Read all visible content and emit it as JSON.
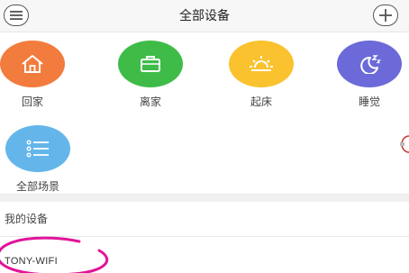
{
  "header": {
    "title": "全部设备",
    "menu_icon": "menu-icon",
    "add_icon": "plus-icon"
  },
  "scenes": [
    {
      "label": "回家",
      "icon": "home-icon",
      "color": "#f27c3d"
    },
    {
      "label": "离家",
      "icon": "briefcase-icon",
      "color": "#3fbc48"
    },
    {
      "label": "起床",
      "icon": "sunrise-icon",
      "color": "#f9c22e"
    },
    {
      "label": "睡觉",
      "icon": "moon-sleep-icon",
      "color": "#6b6ad8"
    },
    {
      "label": "全部场景",
      "icon": "list-icon",
      "color": "#64b6ea"
    }
  ],
  "devices": {
    "section_title": "我的设备",
    "items": [
      {
        "name": "TONY-WIFI"
      }
    ]
  },
  "annotation": {
    "color": "#e0149a"
  }
}
